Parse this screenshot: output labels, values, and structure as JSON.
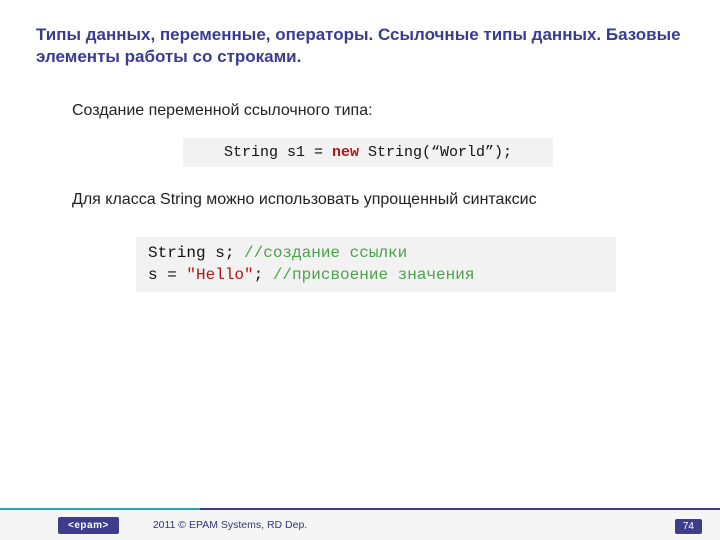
{
  "title": "Типы данных, переменные, операторы. Ссылочные типы данных. Базовые элементы работы со строками.",
  "p1": "Создание переменной ссылочного типа:",
  "code1": {
    "a": "String s1 = ",
    "kw": "new",
    "b": " String(“World”);"
  },
  "p2": "Для класса String можно использовать упрощенный синтаксис",
  "code2": {
    "l1a": "String s; ",
    "l1c": "//создание ссылки",
    "l2a": "s = ",
    "l2s": "\"Hello\"",
    "l2b": "; ",
    "l2c": "//присвоение значения"
  },
  "footer": {
    "logo": "<epam>",
    "copyright": "2011 © EPAM Systems, RD Dep.",
    "page": "74"
  }
}
